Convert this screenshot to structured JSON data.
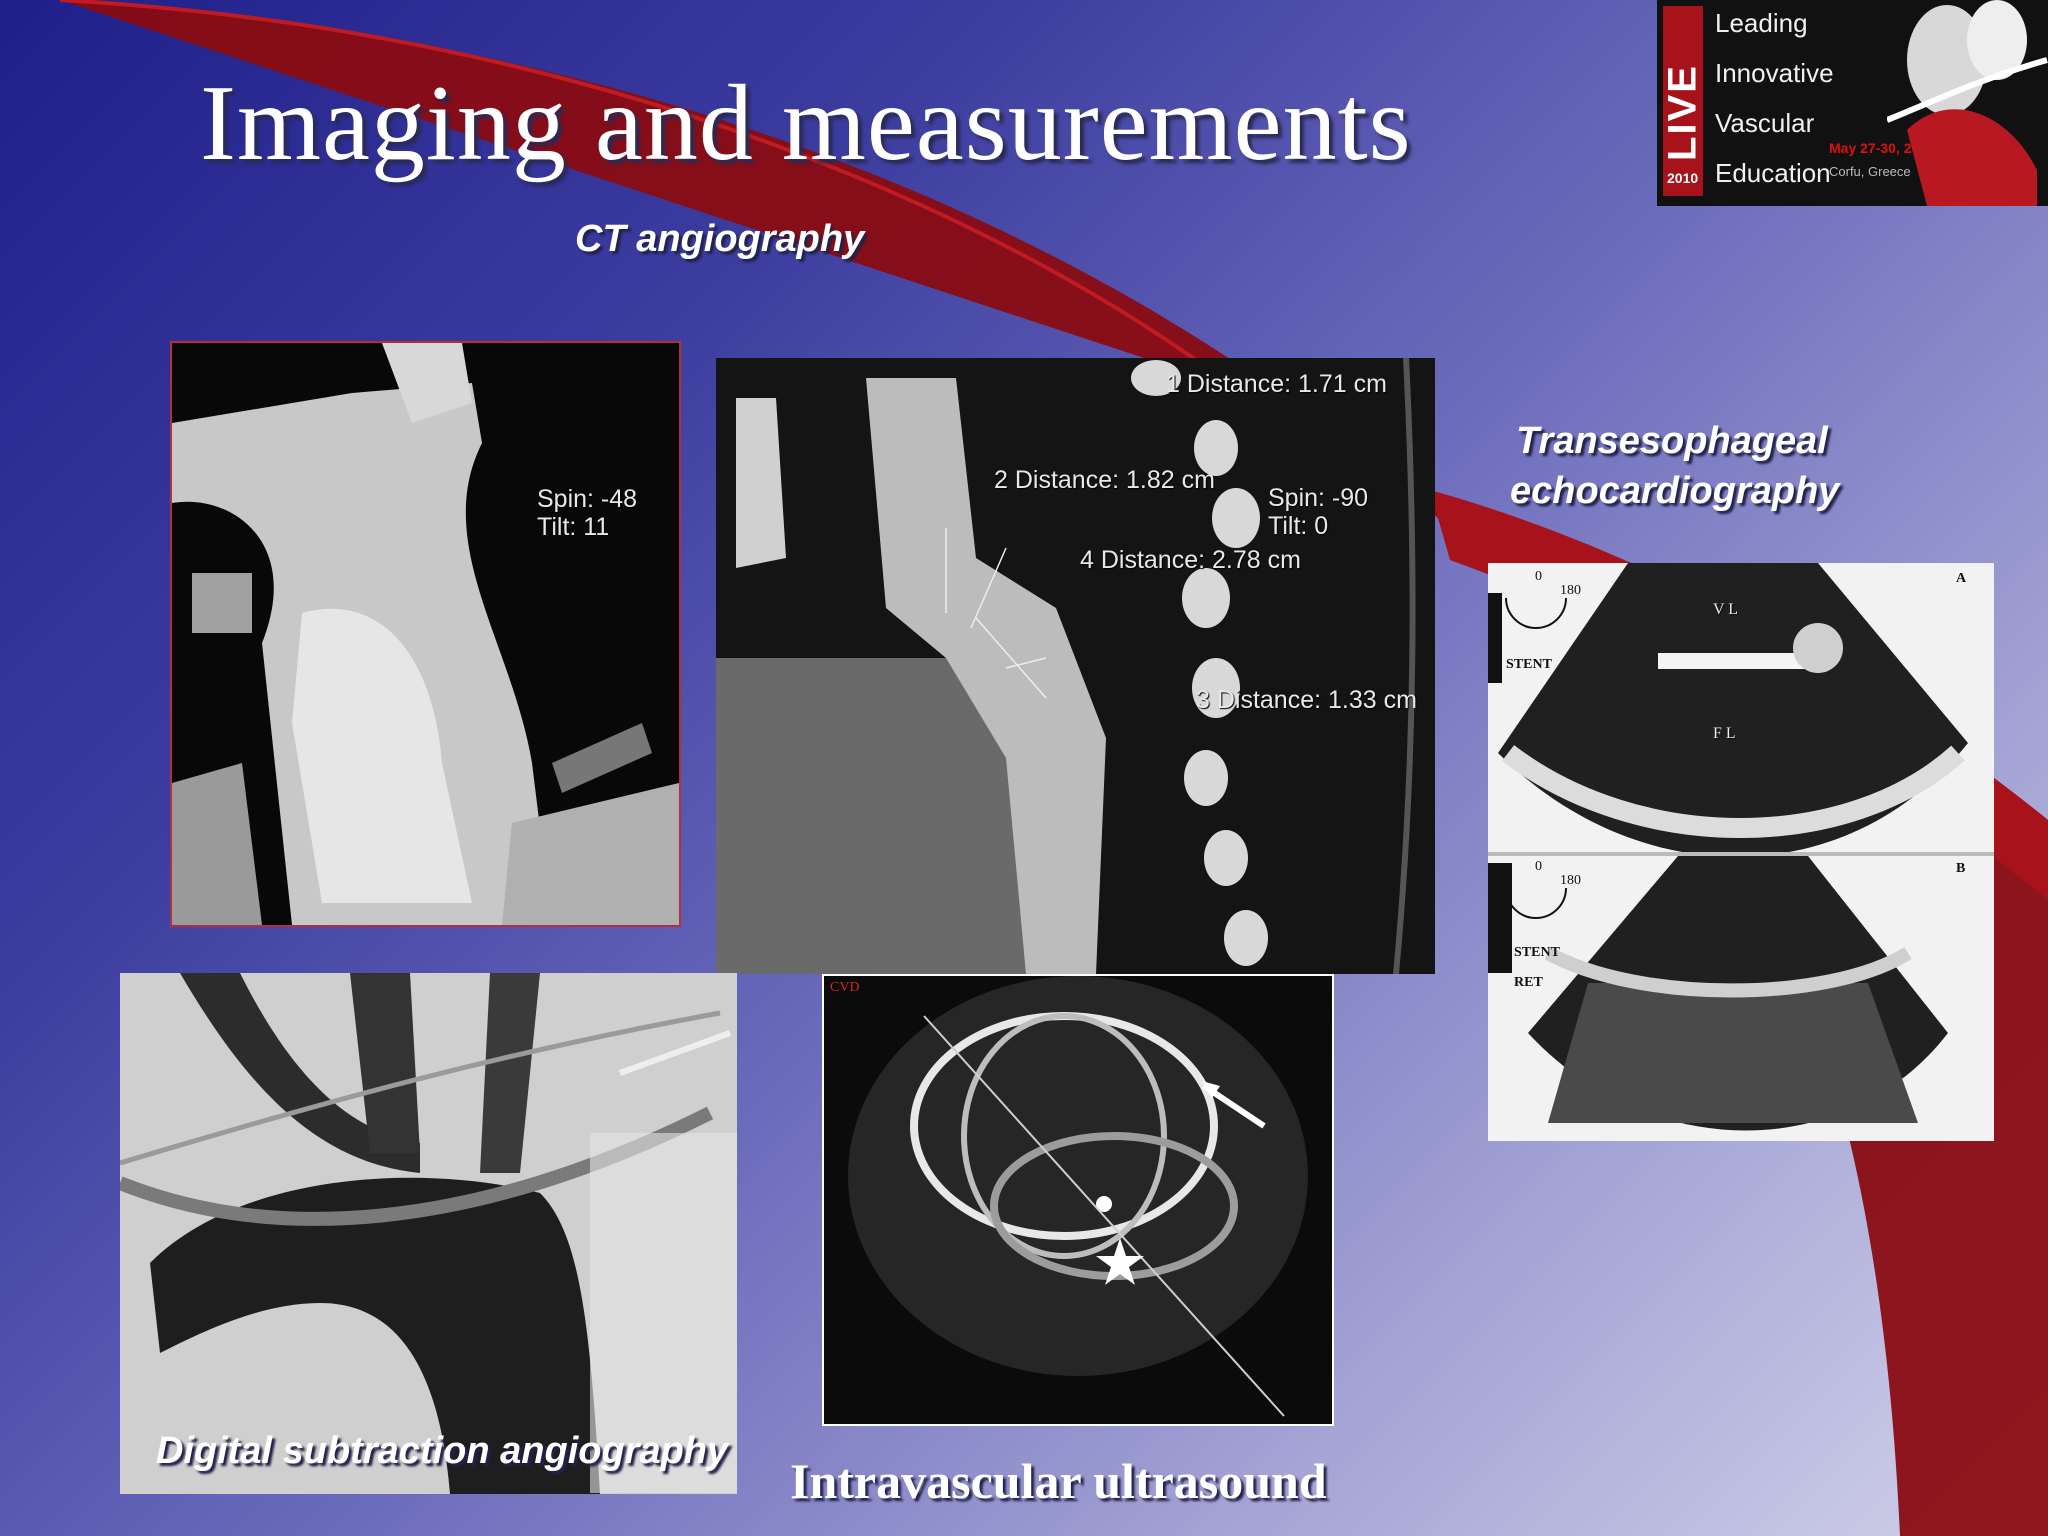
{
  "slide": {
    "title": "Imaging and measurements",
    "captions": {
      "ct": "CT angiography",
      "tee_line1": "Transesophageal",
      "tee_line2": "echocardiography",
      "dsa": "Digital subtraction  angiography",
      "ivus": "Intravascular ultrasound"
    }
  },
  "logo": {
    "live": "LIVE",
    "year": "2010",
    "lines": [
      "Leading",
      "Innovative",
      "Vascular",
      "Education"
    ],
    "dates": "May 27-30, 2010",
    "place": "Corfu, Greece"
  },
  "ct_left": {
    "spin": "Spin: -48",
    "tilt": "Tilt:  11"
  },
  "ct_right": {
    "d1": "1 Distance: 1.71 cm",
    "d2": "2 Distance: 1.82 cm",
    "d3": "3 Distance: 1.33 cm",
    "d4": "4 Distance: 2.78 cm",
    "spin": "Spin: -90",
    "tilt": "Tilt:   0"
  },
  "tee": {
    "top_label": "A",
    "bottom_label": "B",
    "vl": "V L",
    "fl": "F L",
    "stent": "STENT",
    "ret": "RET",
    "angle_0": "0",
    "angle_180": "180"
  },
  "ivus": {
    "tag": "CVD"
  },
  "colors": {
    "background_start": "#1f1f8a",
    "background_end": "#d2d2ea",
    "accent_red": "#b01018"
  }
}
